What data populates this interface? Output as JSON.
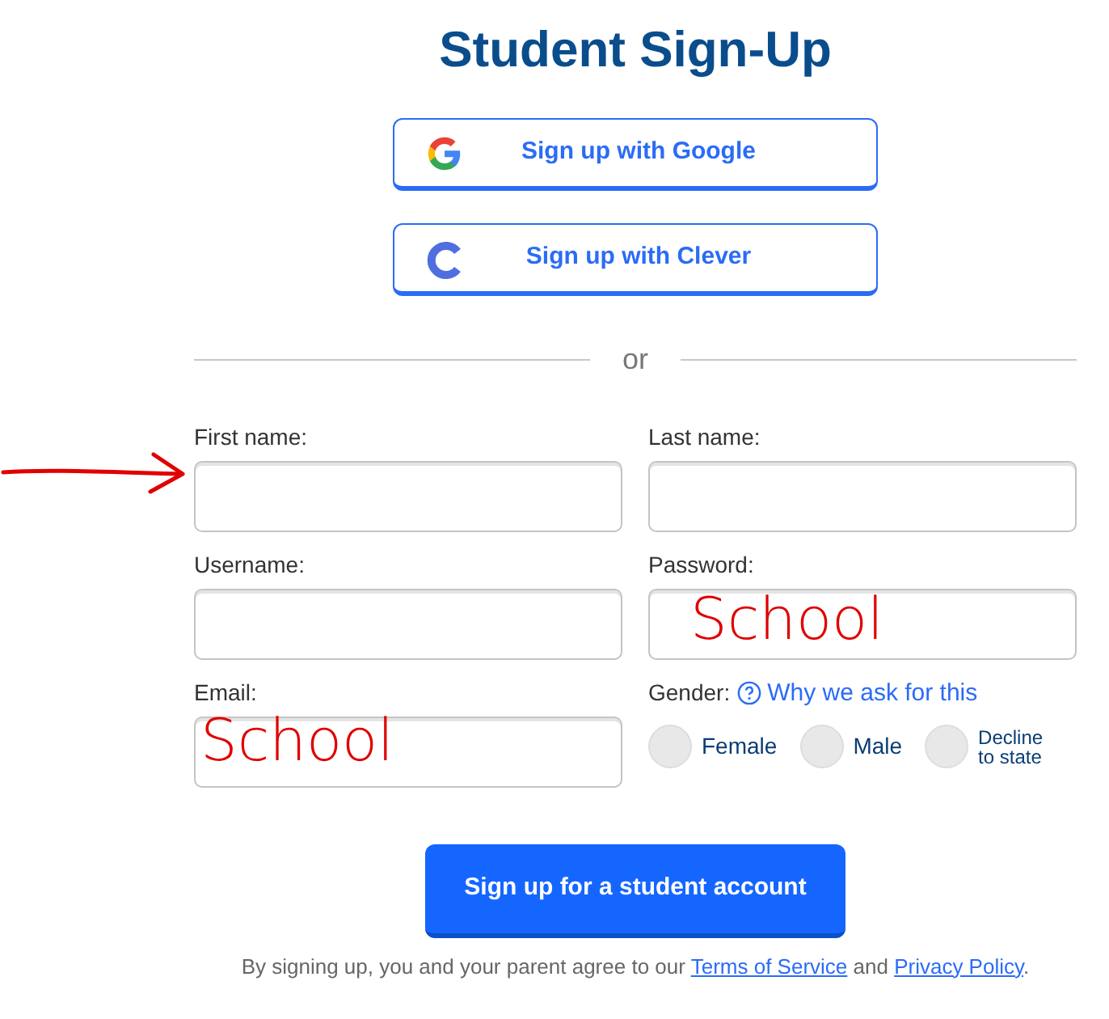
{
  "title": "Student Sign-Up",
  "sso_buttons": [
    {
      "kind": "google",
      "label": "Sign up with Google"
    },
    {
      "kind": "clever",
      "label": "Sign up with Clever"
    }
  ],
  "divider": "or",
  "fields": [
    {
      "label": "First name:"
    },
    {
      "label": "Last name:"
    },
    {
      "label": "Username:"
    },
    {
      "label": "Password:",
      "annotation": "School"
    },
    {
      "label": "Email:",
      "annotation": "School"
    }
  ],
  "gender": {
    "label": "Gender:",
    "help_link": "Why we ask for this",
    "options": [
      {
        "label": "Female",
        "selected": false
      },
      {
        "label": "Male",
        "selected": false
      },
      {
        "label": "Decline to state",
        "selected": false
      }
    ]
  },
  "submit": "Sign up for a student account",
  "footer": [
    {
      "kind": "text",
      "text": "By signing up, you and your parent agree to our "
    },
    {
      "kind": "link",
      "text": "Terms of Service"
    },
    {
      "kind": "text",
      "text": " and "
    },
    {
      "kind": "link",
      "text": "Privacy Policy"
    },
    {
      "kind": "text",
      "text": "."
    }
  ],
  "annotations": [
    {
      "kind": "arrow"
    }
  ]
}
